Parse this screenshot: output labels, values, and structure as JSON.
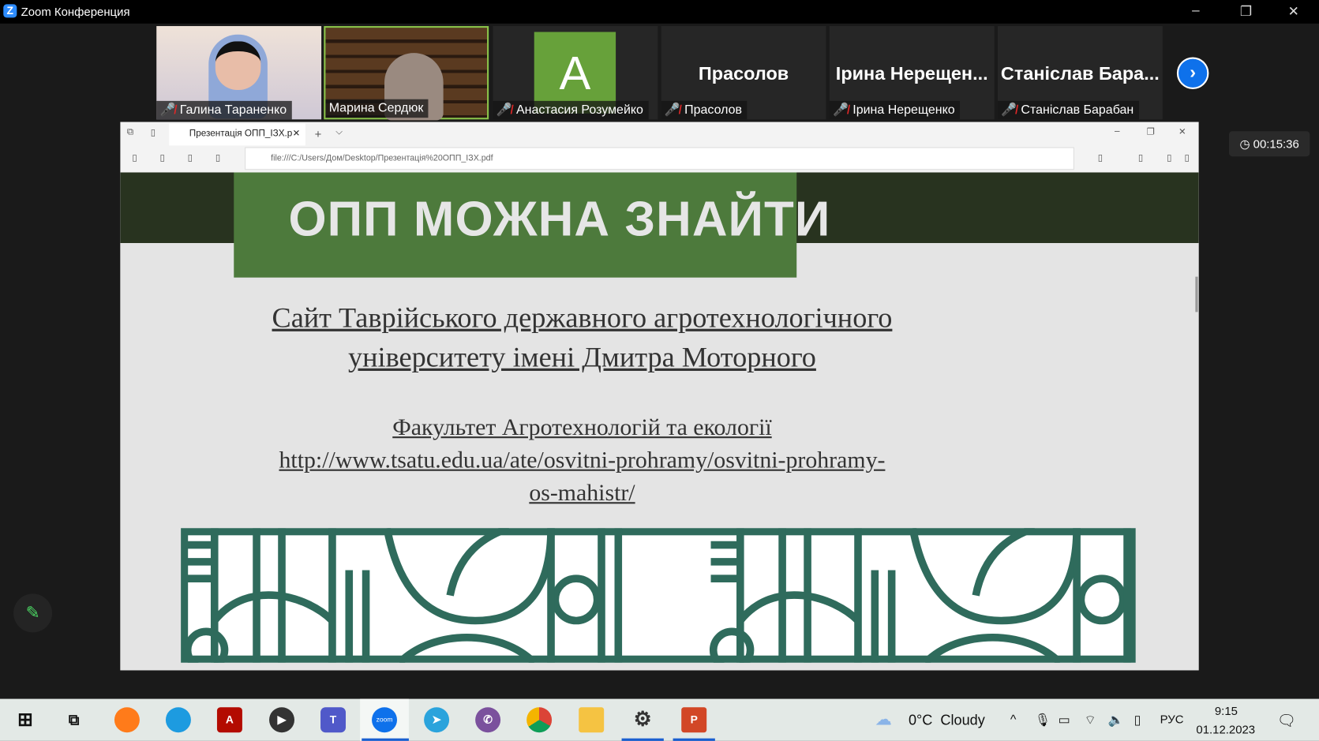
{
  "window": {
    "title": "Zoom Конференция"
  },
  "participants": [
    {
      "name": "Галина Тараненко",
      "muted": true,
      "video": true
    },
    {
      "name": "Марина Сердюк",
      "muted": false,
      "video": true,
      "active_speaker": true
    },
    {
      "name": "Анастасия Розумейко",
      "muted": true,
      "avatar_letter": "A"
    },
    {
      "name": "Прасолов",
      "muted": true,
      "display": "Прасолов"
    },
    {
      "name": "Ірина Нерещенко",
      "muted": true,
      "display": "Ірина  Нерещен..."
    },
    {
      "name": "Станіслав Барабан",
      "muted": true,
      "display": "Станіслав  Бара..."
    }
  ],
  "timer": "00:15:36",
  "browser": {
    "tab_title": "Презентація ОПП_ІЗХ.p",
    "url": "file:///C:/Users/Дом/Desktop/Презентація%20ОПП_ІЗХ.pdf"
  },
  "slide": {
    "title": "ОПП МОЖНА ЗНАЙТИ",
    "line1": "Сайт Таврійського державного агротехнологічного",
    "line2": "університету імені Дмитра Моторного",
    "faculty": "Факультет Агротехнологій та екології",
    "url1": "http://www.tsatu.edu.ua/ate/osvitni-prohramy/osvitni-prohramy-",
    "url2": "os-mahistr/"
  },
  "taskbar": {
    "weather": "0°C  Cloudy",
    "lang": "РУС",
    "time": "9:15",
    "date": "01.12.2023",
    "zoom_label": "zoom"
  },
  "colors": {
    "slide_green": "#4d7a3c",
    "pattern": "#2f6b5c",
    "zoom_blue": "#0e71eb"
  }
}
